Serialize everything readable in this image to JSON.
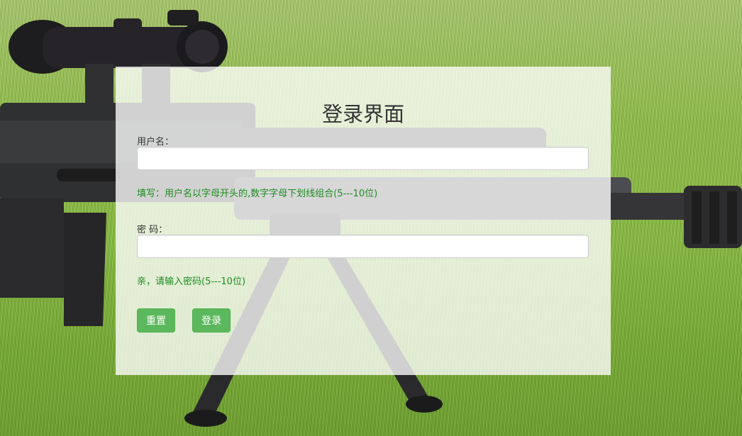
{
  "form": {
    "title": "登录界面",
    "username": {
      "label": "用户名：",
      "value": "",
      "placeholder": "",
      "hint": "填写：用户名以字母开头的,数字字母下划线组合(5---10位)"
    },
    "password": {
      "label": "密 码：",
      "value": "",
      "placeholder": "",
      "hint": "亲，请输入密码(5---10位)"
    },
    "buttons": {
      "reset_label": "重置",
      "login_label": "登录"
    }
  },
  "colors": {
    "button_green": "#5cb85c",
    "hint_green": "#1d8c1d",
    "grass_green": "#86b93f"
  }
}
